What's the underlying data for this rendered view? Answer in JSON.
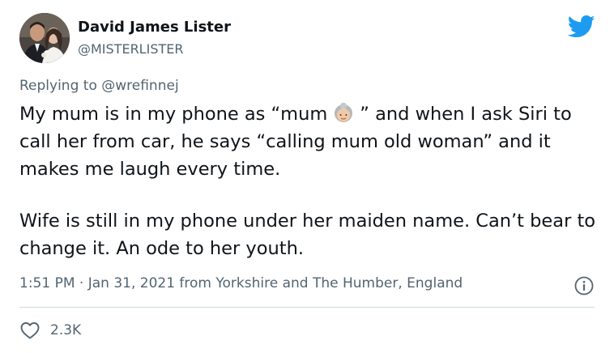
{
  "author": {
    "name": "David James Lister",
    "handle": "@MISTERLISTER"
  },
  "reply": {
    "prefix": "Replying to",
    "mention": "@wrefinnej"
  },
  "tweet": {
    "p1_before_emoji": "My mum is in my phone as “mum",
    "p1_after_emoji": "” and when I ask Siri to call her from car, he says “calling mum old woman” and it makes me laugh every time.",
    "p2": "Wife is still in my phone under her maiden name. Can’t bear to change it. An ode to her youth.",
    "emoji": "old-woman-emoji"
  },
  "meta": {
    "timestamp": "1:51 PM · Jan 31, 2021 from Yorkshire and The Humber, England"
  },
  "actions": {
    "likes": "2.3K"
  },
  "colors": {
    "twitter_blue": "#1d9bf0",
    "secondary_text": "#536471",
    "primary_text": "#0f1419",
    "divider": "#cfd9de"
  },
  "icons": [
    "twitter-bird-icon",
    "info-icon",
    "heart-icon"
  ]
}
